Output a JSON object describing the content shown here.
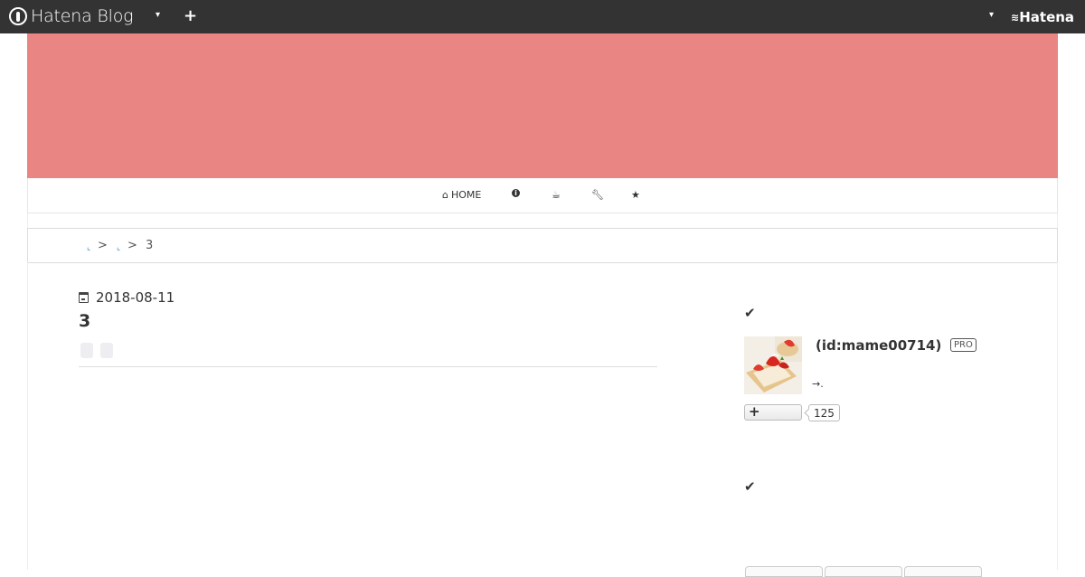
{
  "globalbar": {
    "brand": "Hatena Blog",
    "dropdown_caret": "▾",
    "add_icon": "plus-icon",
    "right_caret": "▾",
    "hatena_label": "Hatena"
  },
  "colors": {
    "globalbar_bg": "#333333",
    "banner_bg": "#e98582",
    "link": "#2b7bb9"
  },
  "nav": {
    "items": [
      {
        "label": "HOME",
        "icon": "home-icon"
      },
      {
        "label": "",
        "icon": "info-icon"
      },
      {
        "label": "",
        "icon": "coffee-icon"
      },
      {
        "label": "",
        "icon": "wrench-icon"
      },
      {
        "label": "",
        "icon": "star-icon"
      }
    ]
  },
  "breadcrumb": {
    "items": [
      "",
      ""
    ],
    "separator": ">",
    "current": "3"
  },
  "article": {
    "date": "2018-08-11",
    "title": "3"
  },
  "sidebar": {
    "profile": {
      "id": "(id:mame00714)",
      "badge": "PRO",
      "note": "→.",
      "follow_icon": "plus-icon",
      "follower_count": "125"
    }
  }
}
